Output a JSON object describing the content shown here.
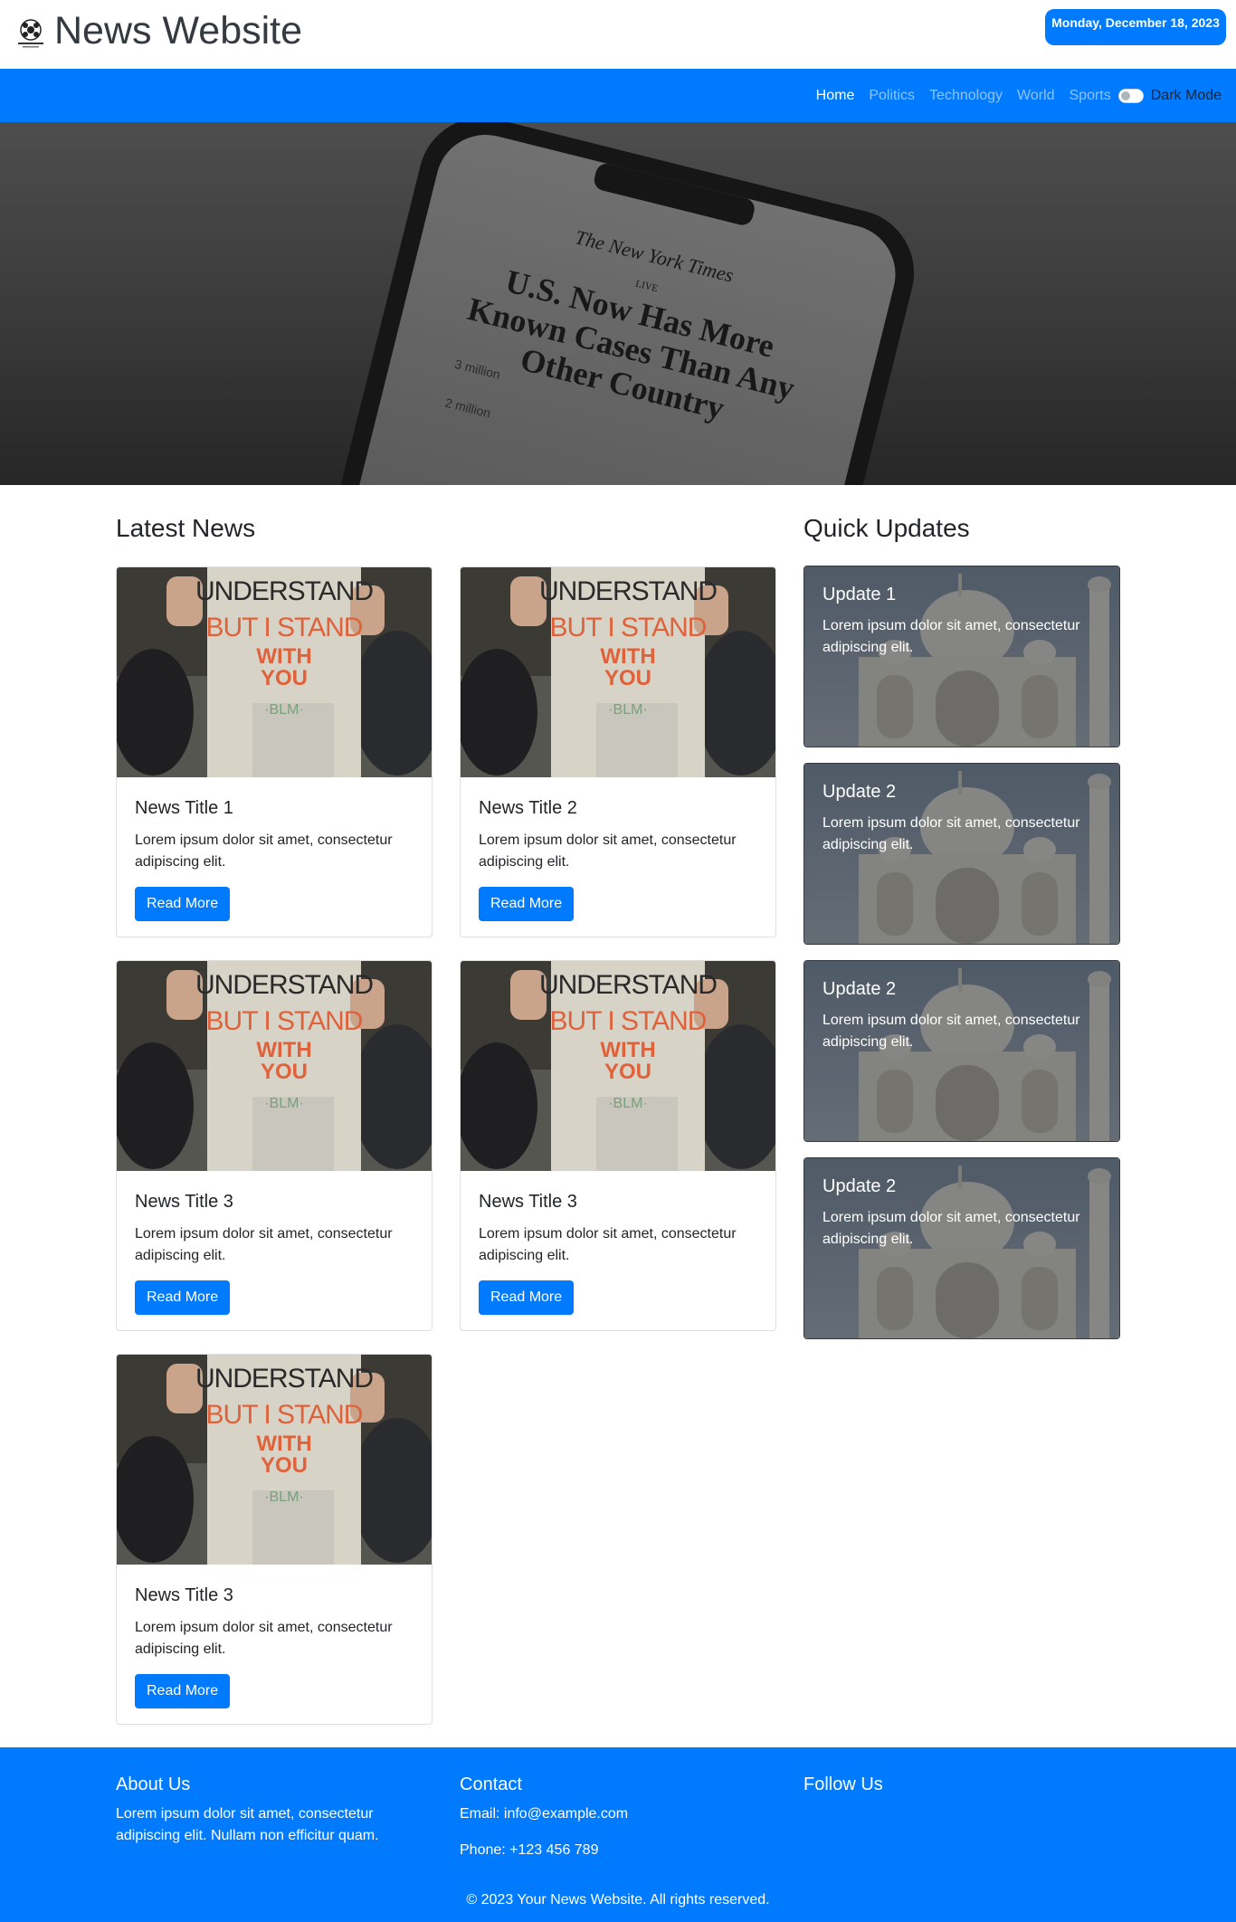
{
  "header": {
    "site_title": "News Website",
    "date": "Monday, December 18, 2023"
  },
  "nav": {
    "items": [
      {
        "label": "Home",
        "active": true
      },
      {
        "label": "Politics",
        "active": false
      },
      {
        "label": "Technology",
        "active": false
      },
      {
        "label": "World",
        "active": false
      },
      {
        "label": "Sports",
        "active": false
      }
    ],
    "dark_mode_label": "Dark Mode"
  },
  "hero": {
    "paper_name": "The New York Times",
    "live": "LIVE",
    "headline_1": "U.S. Now Has More",
    "headline_2": "Known Cases Than Any",
    "headline_3": "Other Country",
    "stat_1": "3 million",
    "stat_2": "2 million"
  },
  "latest": {
    "title": "Latest News",
    "sign_line_1": "UNDERSTAND",
    "sign_line_2": "BUT I STAND",
    "sign_line_3": "WITH",
    "sign_line_4": "YOU",
    "sign_line_5": "BLM",
    "cards": [
      {
        "title": "News Title 1",
        "text": "Lorem ipsum dolor sit amet, consectetur adipiscing elit.",
        "button": "Read More"
      },
      {
        "title": "News Title 2",
        "text": "Lorem ipsum dolor sit amet, consectetur adipiscing elit.",
        "button": "Read More"
      },
      {
        "title": "News Title 3",
        "text": "Lorem ipsum dolor sit amet, consectetur adipiscing elit.",
        "button": "Read More"
      },
      {
        "title": "News Title 3",
        "text": "Lorem ipsum dolor sit amet, consectetur adipiscing elit.",
        "button": "Read More"
      },
      {
        "title": "News Title 3",
        "text": "Lorem ipsum dolor sit amet, consectetur adipiscing elit.",
        "button": "Read More"
      }
    ]
  },
  "updates": {
    "title": "Quick Updates",
    "items": [
      {
        "title": "Update 1",
        "text": "Lorem ipsum dolor sit amet, consectetur adipiscing elit."
      },
      {
        "title": "Update 2",
        "text": "Lorem ipsum dolor sit amet, consectetur adipiscing elit."
      },
      {
        "title": "Update 2",
        "text": "Lorem ipsum dolor sit amet, consectetur adipiscing elit."
      },
      {
        "title": "Update 2",
        "text": "Lorem ipsum dolor sit amet, consectetur adipiscing elit."
      }
    ]
  },
  "footer": {
    "about_title": "About Us",
    "about_text": "Lorem ipsum dolor sit amet, consectetur adipiscing elit. Nullam non efficitur quam.",
    "contact_title": "Contact",
    "email": "Email: info@example.com",
    "phone": "Phone: +123 456 789",
    "follow_title": "Follow Us",
    "copyright": "© 2023 Your News Website. All rights reserved."
  },
  "colors": {
    "primary": "#007bff",
    "text": "#212529",
    "title": "#343a40"
  }
}
